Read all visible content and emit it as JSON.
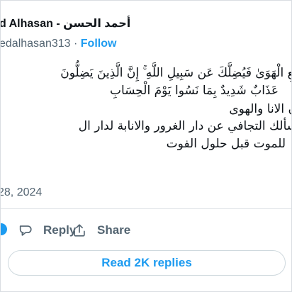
{
  "author": {
    "name": "d Alhasan - أحمد الحسن",
    "handle": "edalhasan313",
    "separator": "·",
    "follow_label": "Follow"
  },
  "tweet": {
    "lines": [
      "وَلَا تَتَّبِعِ الْهَوَىٰ فَيُضِلَّكَ عَن سَبِيلِ اللَّهِ ۚ إِنَّ الَّذِينَ يَضِلُّونَ",
      "عَذَابٌ شَدِيدٌ بِمَا نَسُوا يَوْمَ الْحِسَابِ",
      "ن الانا والهوى",
      "سألك التجافي عن دار الغرور والانابة لدار ال",
      "للموت قبل حلول الفوت",
      ""
    ]
  },
  "timestamp": "28, 2024",
  "actions": {
    "reply_label": "Reply",
    "share_label": "Share",
    "reply_icon": "speech-bubble-icon",
    "share_icon": "share-arrow-icon",
    "like_icon": "heart-icon"
  },
  "read_replies_label": "Read 2K replies",
  "colors": {
    "accent": "#1d9bf0",
    "text": "#0f1419",
    "muted": "#536471",
    "border": "#cfd9de"
  }
}
